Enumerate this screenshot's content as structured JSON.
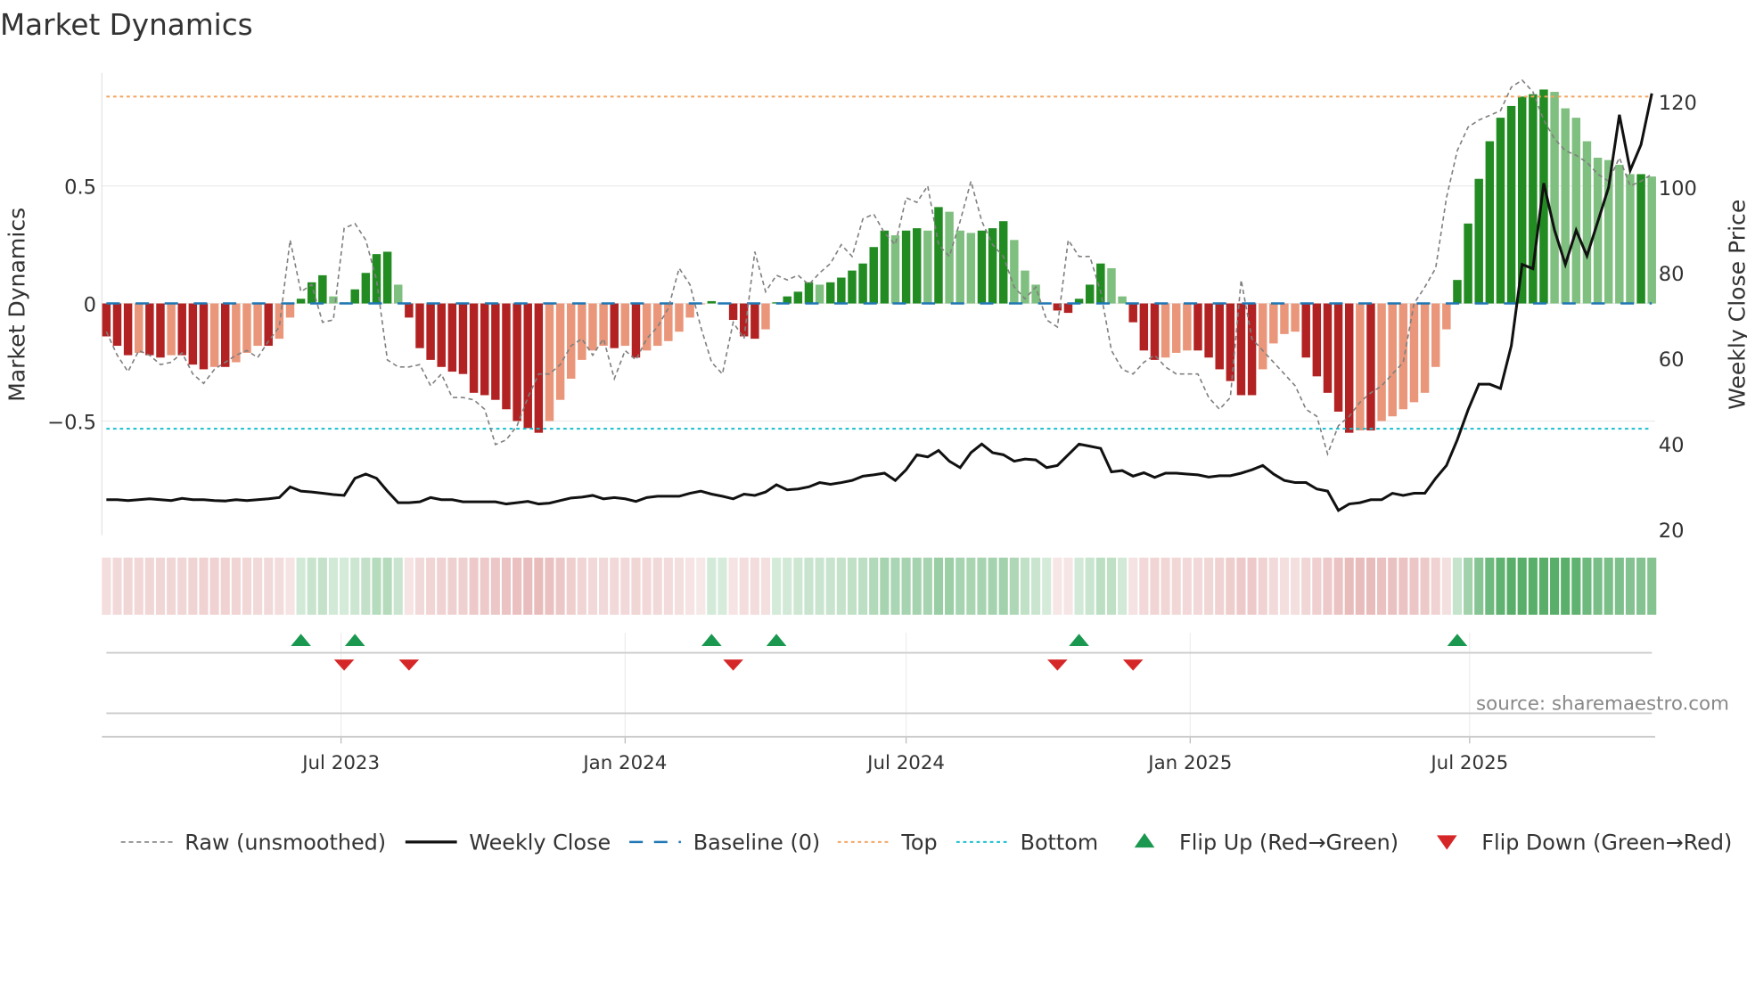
{
  "chart_data": {
    "type": "bar",
    "title": "Market Dynamics",
    "ylabel": "Market Dynamics",
    "y2label": "Weekly Close Price",
    "ylim": [
      -0.98,
      1.0
    ],
    "y2lim": [
      16,
      130
    ],
    "yticks": [
      {
        "v": 0.5,
        "label": "0.5"
      },
      {
        "v": 0,
        "label": "0"
      },
      {
        "v": -0.5,
        "label": "−0.5"
      }
    ],
    "y2ticks": [
      20,
      40,
      60,
      80,
      100,
      120
    ],
    "start_date": "2023-01-30",
    "xticks": [
      {
        "date": "2023-07-01",
        "label": "Jul 2023"
      },
      {
        "date": "2024-01-01",
        "label": "Jan 2024"
      },
      {
        "date": "2024-07-01",
        "label": "Jul 2024"
      },
      {
        "date": "2025-01-01",
        "label": "Jan 2025"
      },
      {
        "date": "2025-07-01",
        "label": "Jul 2025"
      }
    ],
    "top_level": 0.88,
    "bottom_level": -0.533,
    "baseline": 0,
    "values": [
      -0.14,
      -0.18,
      -0.22,
      -0.21,
      -0.22,
      -0.23,
      -0.22,
      -0.22,
      -0.26,
      -0.28,
      -0.27,
      -0.27,
      -0.25,
      -0.21,
      -0.18,
      -0.18,
      -0.15,
      -0.06,
      0.02,
      0.09,
      0.12,
      0.03,
      0.005,
      0.06,
      0.13,
      0.21,
      0.22,
      0.08,
      -0.06,
      -0.19,
      -0.24,
      -0.27,
      -0.29,
      -0.3,
      -0.38,
      -0.39,
      -0.41,
      -0.45,
      -0.5,
      -0.53,
      -0.55,
      -0.5,
      -0.41,
      -0.32,
      -0.24,
      -0.2,
      -0.18,
      -0.19,
      -0.18,
      -0.23,
      -0.2,
      -0.18,
      -0.16,
      -0.12,
      -0.06,
      -0.003,
      0.01,
      0.0,
      -0.07,
      -0.14,
      -0.15,
      -0.11,
      0.005,
      0.03,
      0.05,
      0.09,
      0.08,
      0.09,
      0.11,
      0.14,
      0.17,
      0.24,
      0.31,
      0.29,
      0.31,
      0.32,
      0.31,
      0.41,
      0.39,
      0.31,
      0.3,
      0.31,
      0.32,
      0.35,
      0.27,
      0.14,
      0.08,
      0.003,
      -0.03,
      -0.04,
      0.02,
      0.08,
      0.17,
      0.15,
      0.03,
      -0.08,
      -0.2,
      -0.24,
      -0.23,
      -0.21,
      -0.2,
      -0.2,
      -0.23,
      -0.28,
      -0.33,
      -0.39,
      -0.39,
      -0.28,
      -0.17,
      -0.13,
      -0.12,
      -0.23,
      -0.31,
      -0.38,
      -0.46,
      -0.55,
      -0.54,
      -0.54,
      -0.5,
      -0.48,
      -0.45,
      -0.42,
      -0.38,
      -0.27,
      -0.11,
      0.1,
      0.34,
      0.53,
      0.69,
      0.79,
      0.84,
      0.88,
      0.89,
      0.91,
      0.9,
      0.83,
      0.79,
      0.69,
      0.62,
      0.61,
      0.59,
      0.55,
      0.55,
      0.54
    ],
    "raw": [
      -0.12,
      -0.22,
      -0.29,
      -0.2,
      -0.22,
      -0.26,
      -0.25,
      -0.21,
      -0.3,
      -0.34,
      -0.28,
      -0.25,
      -0.22,
      -0.2,
      -0.23,
      -0.16,
      -0.1,
      0.27,
      0.05,
      0.08,
      -0.08,
      -0.07,
      0.32,
      0.34,
      0.27,
      0.1,
      -0.24,
      -0.27,
      -0.27,
      -0.26,
      -0.35,
      -0.3,
      -0.4,
      -0.4,
      -0.41,
      -0.45,
      -0.6,
      -0.58,
      -0.52,
      -0.4,
      -0.3,
      -0.3,
      -0.26,
      -0.18,
      -0.15,
      -0.22,
      -0.15,
      -0.32,
      -0.2,
      -0.24,
      -0.15,
      -0.1,
      -0.02,
      0.15,
      0.08,
      -0.1,
      -0.25,
      -0.3,
      -0.08,
      -0.15,
      0.22,
      0.05,
      0.12,
      0.1,
      0.12,
      0.08,
      0.13,
      0.17,
      0.25,
      0.2,
      0.36,
      0.38,
      0.3,
      0.25,
      0.45,
      0.43,
      0.5,
      0.25,
      0.2,
      0.35,
      0.52,
      0.35,
      0.25,
      0.2,
      0.07,
      0.02,
      0.07,
      -0.07,
      -0.1,
      0.27,
      0.2,
      0.2,
      0.05,
      -0.2,
      -0.28,
      -0.3,
      -0.25,
      -0.22,
      -0.27,
      -0.3,
      -0.3,
      -0.3,
      -0.4,
      -0.45,
      -0.4,
      0.1,
      -0.15,
      -0.2,
      -0.25,
      -0.3,
      -0.35,
      -0.45,
      -0.48,
      -0.64,
      -0.52,
      -0.48,
      -0.42,
      -0.38,
      -0.35,
      -0.3,
      -0.25,
      0.0,
      0.07,
      0.15,
      0.45,
      0.65,
      0.75,
      0.78,
      0.8,
      0.82,
      0.92,
      0.95,
      0.9,
      0.78,
      0.7,
      0.65,
      0.63,
      0.6,
      0.55,
      0.52,
      0.62,
      0.5,
      0.52,
      0.55
    ],
    "close": [
      27,
      27,
      26.8,
      27,
      27.2,
      27,
      26.8,
      27.3,
      27,
      27,
      26.8,
      26.7,
      27,
      26.8,
      27,
      27.2,
      27.5,
      30,
      29,
      28.8,
      28.5,
      28.2,
      28,
      32,
      33,
      32,
      29,
      26.3,
      26.3,
      26.5,
      27.5,
      27,
      27,
      26.5,
      26.5,
      26.5,
      26.5,
      26,
      26.3,
      26.6,
      26,
      26.2,
      26.8,
      27.4,
      27.6,
      28,
      27.2,
      27.5,
      27.2,
      26.6,
      27.5,
      27.8,
      27.8,
      27.8,
      28.5,
      29,
      28.3,
      27.8,
      27.2,
      28.3,
      28,
      28.8,
      30.5,
      29.3,
      29.5,
      30,
      31,
      30.6,
      31,
      31.5,
      32.5,
      32.8,
      33.2,
      31.5,
      34,
      37.5,
      37,
      38.5,
      36,
      34.5,
      38,
      40,
      38,
      37.5,
      36,
      36.5,
      36.3,
      34.5,
      35,
      37.5,
      40,
      39.5,
      39,
      33.5,
      33.8,
      32.5,
      33.3,
      32.2,
      33.2,
      33.2,
      33,
      32.8,
      32.3,
      32.6,
      32.6,
      33.2,
      34,
      35,
      33,
      31.5,
      31,
      31,
      29.5,
      29,
      24.5,
      26,
      26.3,
      27,
      27,
      28.5,
      28,
      28.5,
      28.5,
      32,
      35,
      41,
      48,
      54,
      54,
      53,
      63,
      82,
      81,
      101,
      90,
      82,
      90,
      84,
      92,
      100,
      117,
      104,
      110,
      122
    ],
    "flip_up_index": [
      18,
      23,
      56,
      62,
      90,
      125
    ],
    "flip_down_index": [
      22,
      28,
      58,
      88,
      95
    ],
    "colors": {
      "dark_green": "#228b22",
      "light_green": "#7fbf7f",
      "dark_red": "#b22222",
      "light_red": "#e9967a",
      "top": "#f4a460",
      "bottom": "#17becf",
      "baseline": "#1f77b4",
      "flip_up": "#1a9850",
      "flip_down": "#d62728",
      "close": "#111111",
      "raw": "#808080"
    },
    "legend": [
      {
        "label": "Raw (unsmoothed)",
        "style": "raw"
      },
      {
        "label": "Weekly Close",
        "style": "close"
      },
      {
        "label": "Baseline (0)",
        "style": "baseline"
      },
      {
        "label": "Top",
        "style": "top"
      },
      {
        "label": "Bottom",
        "style": "bottom"
      },
      {
        "label": "Flip Up (Red→Green)",
        "style": "up"
      },
      {
        "label": "Flip Down (Green→Red)",
        "style": "down"
      }
    ],
    "legend_position": "bottom",
    "source": "source: sharemaestro.com"
  }
}
